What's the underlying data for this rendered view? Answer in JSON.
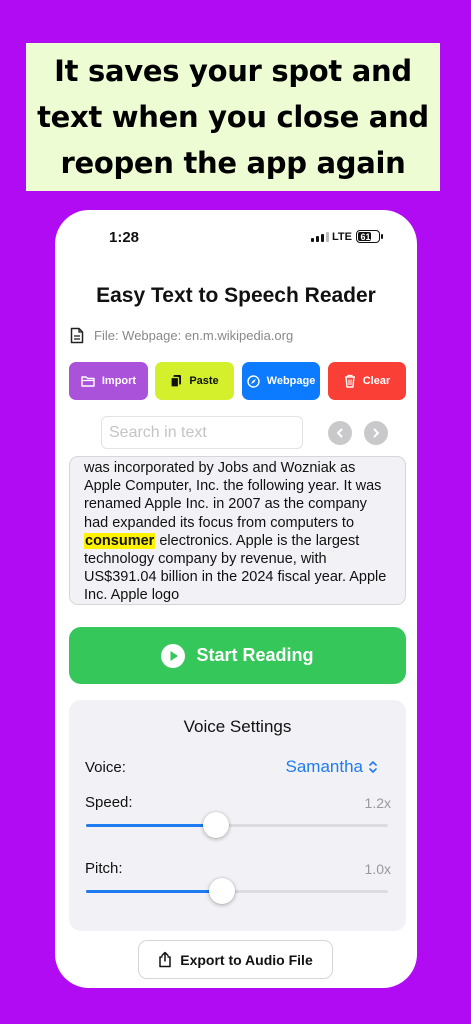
{
  "banner": {
    "text": "It saves your spot and text when you close and reopen the app again"
  },
  "status_bar": {
    "time": "1:28",
    "network": "LTE",
    "battery": "61"
  },
  "app": {
    "title": "Easy Text to Speech Reader",
    "file_label": "File: Webpage: en.m.wikipedia.org"
  },
  "actions": {
    "import": "Import",
    "paste": "Paste",
    "webpage": "Webpage",
    "clear": "Clear"
  },
  "search": {
    "placeholder": "Search in text",
    "value": ""
  },
  "reader": {
    "text_before": "was incorporated by Jobs and Wozniak as Apple Computer, Inc. the following year. It was renamed Apple Inc. in 2007 as the company had expanded its focus from computers to ",
    "highlighted_word": "consumer",
    "text_after": " electronics. Apple is the largest technology company by revenue, with US$391.04 billion in the 2024 fiscal year. Apple Inc. Apple logo"
  },
  "start_button": {
    "label": "Start Reading"
  },
  "voice_settings": {
    "title": "Voice Settings",
    "voice_label": "Voice:",
    "voice_value": "Samantha",
    "speed_label": "Speed:",
    "speed_value": "1.2x",
    "speed_fraction": 0.43,
    "pitch_label": "Pitch:",
    "pitch_value": "1.0x",
    "pitch_fraction": 0.45
  },
  "export_button": {
    "label": "Export to Audio File"
  },
  "colors": {
    "background": "#B10BF4",
    "banner": "#EEFCD3",
    "import": "#AB52DA",
    "paste": "#D4F02D",
    "webpage": "#0D7BFF",
    "clear": "#FA4036",
    "start": "#35C759",
    "accent": "#1E7BF0",
    "highlight": "#FFF200"
  },
  "icons": {
    "file": "document-icon",
    "import": "folder-icon",
    "paste": "clipboard-icon",
    "webpage": "compass-icon",
    "clear": "trash-icon",
    "prev": "chevron-left-icon",
    "next": "chevron-right-icon",
    "start": "play-circle-icon",
    "voice": "chevron-up-down-icon",
    "export": "share-icon"
  }
}
